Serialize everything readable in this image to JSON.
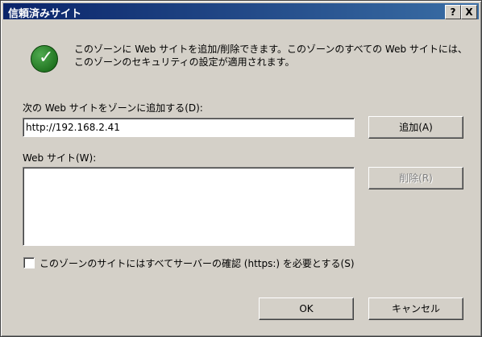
{
  "window": {
    "title": "信頼済みサイト",
    "help_button": "?",
    "close_button": "X"
  },
  "message": "このゾーンに Web サイトを追加/削除できます。このゾーンのすべての Web サイトには、このゾーンのセキュリティの設定が適用されます。",
  "add_site": {
    "label": "次の Web サイトをゾーンに追加する(D):",
    "value": "http://192.168.2.41",
    "button": "追加(A)"
  },
  "sites": {
    "label": "Web サイト(W):",
    "items": [],
    "remove_button": "削除(R)"
  },
  "https_requirement": {
    "label": "このゾーンのサイトにはすべてサーバーの確認 (https:) を必要とする(S)",
    "checked": false
  },
  "footer": {
    "ok": "OK",
    "cancel": "キャンセル"
  },
  "icons": {
    "info": "checkmark-icon"
  }
}
